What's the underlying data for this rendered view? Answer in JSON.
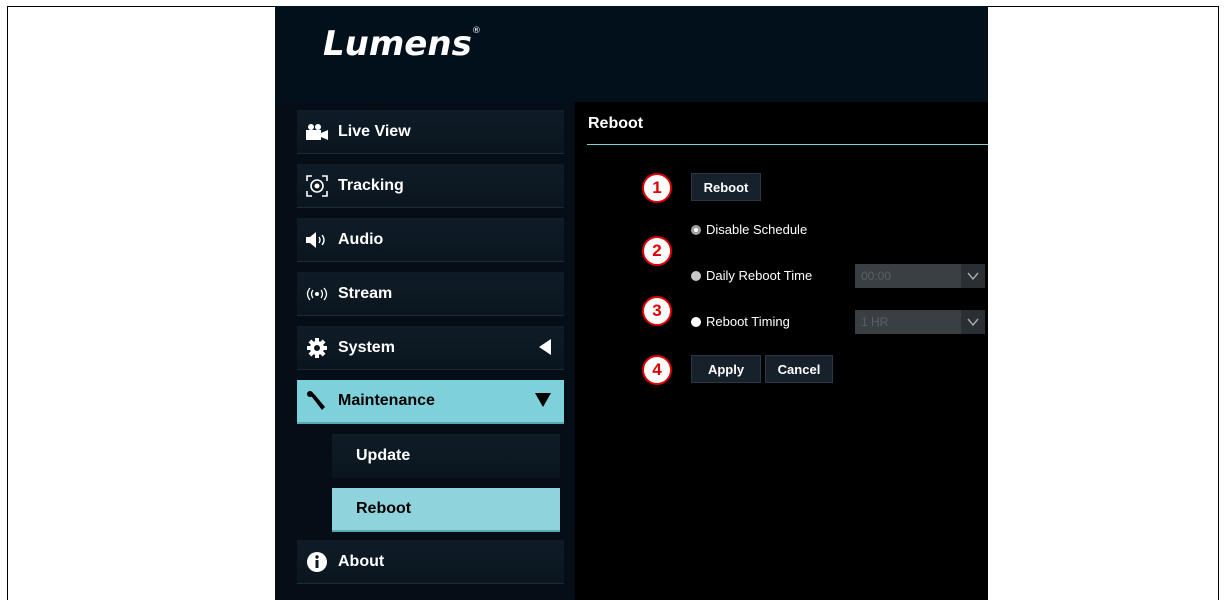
{
  "brand": {
    "logo_text": "Lumens",
    "registered": "®"
  },
  "sidebar": {
    "items": [
      {
        "label": "Live View",
        "icon": "video-camera-icon"
      },
      {
        "label": "Tracking",
        "icon": "tracking-target-icon"
      },
      {
        "label": "Audio",
        "icon": "speaker-icon"
      },
      {
        "label": "Stream",
        "icon": "broadcast-icon"
      },
      {
        "label": "System",
        "icon": "gear-icon",
        "arrow": "◀"
      },
      {
        "label": "Maintenance",
        "icon": "wrench-icon",
        "arrow": "▼",
        "active": true
      },
      {
        "label": "About",
        "icon": "info-icon"
      }
    ],
    "subitems": [
      {
        "label": "Update"
      },
      {
        "label": "Reboot",
        "active": true
      }
    ]
  },
  "content": {
    "title": "Reboot",
    "reboot_button": "Reboot",
    "options": {
      "disable_schedule": "Disable Schedule",
      "daily_reboot_time": "Daily Reboot Time",
      "reboot_timing": "Reboot Timing",
      "selected": "Disable Schedule"
    },
    "daily_time_value": "00:00",
    "timing_value": "1 HR",
    "apply_label": "Apply",
    "cancel_label": "Cancel",
    "callouts": [
      "1",
      "2",
      "3",
      "4"
    ]
  },
  "colors": {
    "accent": "#7ed0da",
    "callout": "#e00000",
    "background": "#000000"
  }
}
